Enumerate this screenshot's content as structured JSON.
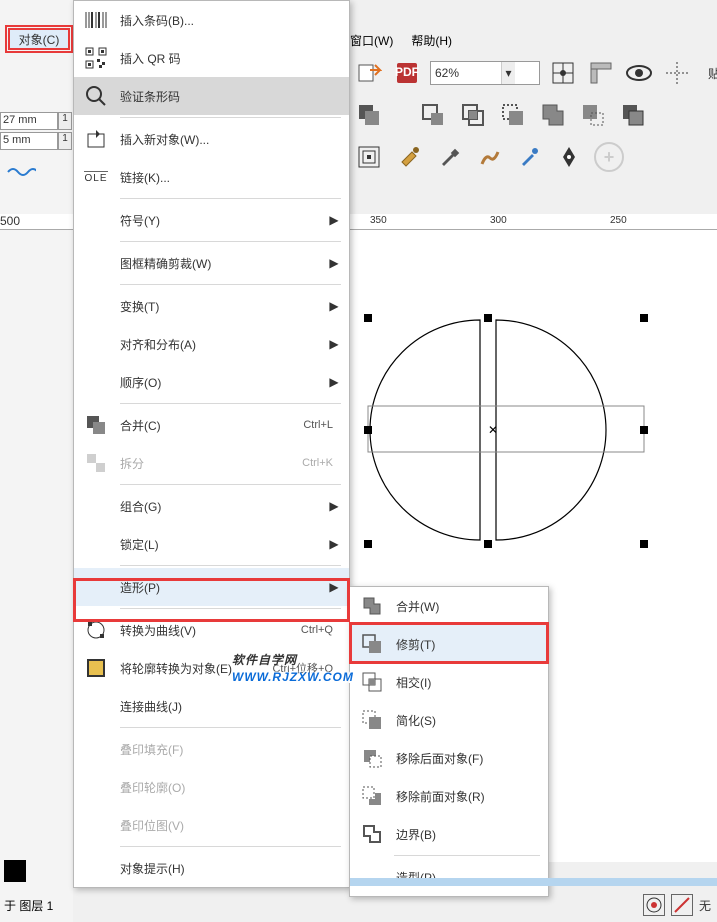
{
  "menubar": {
    "object": "对象(C)",
    "window": "窗口(W)",
    "help": "帮助(H)"
  },
  "zoom": "62%",
  "left": {
    "dim1": "27 mm",
    "dim2": "5 mm",
    "spin1": "1",
    "spin2": "1"
  },
  "ruler": {
    "a": "500",
    "b": "350",
    "c": "300",
    "d": "250"
  },
  "menu": {
    "insert_barcode": "插入条码(B)...",
    "insert_qr": "插入 QR 码",
    "verify_barcode": "验证条形码",
    "insert_new_obj": "插入新对象(W)...",
    "links": "链接(K)...",
    "symbols": "符号(Y)",
    "powerclip": "图框精确剪裁(W)",
    "transform": "变换(T)",
    "align_dist": "对齐和分布(A)",
    "order": "顺序(O)",
    "combine": "合并(C)",
    "combine_kbd": "Ctrl+L",
    "break": "拆分",
    "break_kbd": "Ctrl+K",
    "group": "组合(G)",
    "lock": "锁定(L)",
    "shaping": "造形(P)",
    "to_curves": "转换为曲线(V)",
    "to_curves_kbd": "Ctrl+Q",
    "outline_to_obj": "将轮廓转换为对象(E)",
    "outline_kbd": "Ctrl+位移+Q",
    "join_curves": "连接曲线(J)",
    "overprint_fill": "叠印填充(F)",
    "overprint_outline": "叠印轮廓(O)",
    "overprint_bitmap": "叠印位图(V)",
    "obj_hint": "对象提示(H)"
  },
  "submenu": {
    "weld": "合并(W)",
    "trim": "修剪(T)",
    "intersect": "相交(I)",
    "simplify": "简化(S)",
    "front_minus": "移除后面对象(F)",
    "back_minus": "移除前面对象(R)",
    "boundary": "边界(B)",
    "shaping": "造型(P)"
  },
  "status": {
    "layer": "于 图层 1",
    "none": "无"
  },
  "watermark": {
    "main": "软件自学网",
    "sub": "WWW.RJZXW.COM"
  }
}
